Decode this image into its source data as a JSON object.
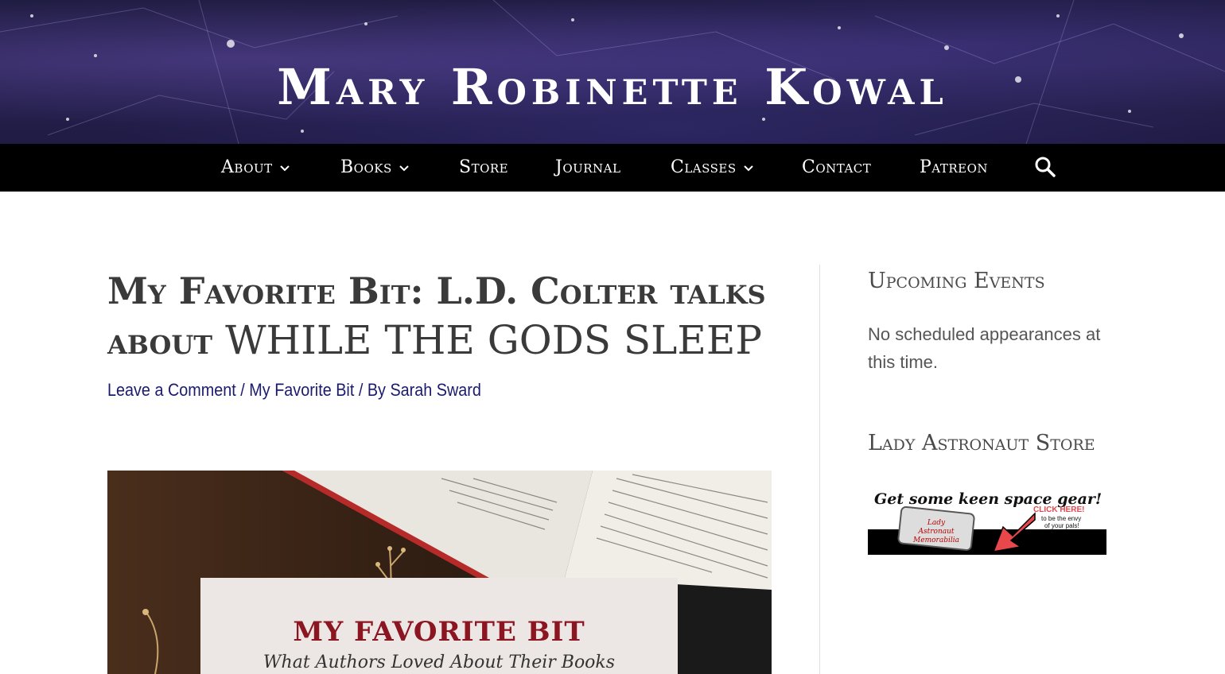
{
  "site": {
    "title": "Mary Robinette Kowal"
  },
  "nav": {
    "items": [
      {
        "label": "About",
        "has_dropdown": true
      },
      {
        "label": "Books",
        "has_dropdown": true
      },
      {
        "label": "Store",
        "has_dropdown": false
      },
      {
        "label": "Journal",
        "has_dropdown": false
      },
      {
        "label": "Classes",
        "has_dropdown": true
      },
      {
        "label": "Contact",
        "has_dropdown": false
      },
      {
        "label": "Patreon",
        "has_dropdown": false
      }
    ],
    "search_icon": "search-icon"
  },
  "post": {
    "title_prefix": "My Favorite Bit: L.D. Colter talks about",
    "title_book": "WHILE THE GODS SLEEP",
    "meta": {
      "comments": "Leave a Comment",
      "sep1": " / ",
      "category": "My Favorite Bit",
      "sep2": " / By ",
      "author": "Sarah Sward"
    },
    "image": {
      "card_title": "MY FAVORITE BIT",
      "card_subtitle": "What Authors Loved About Their Books"
    }
  },
  "sidebar": {
    "events": {
      "title": "Upcoming Events",
      "text": "No scheduled appearances at this time."
    },
    "store": {
      "title": "Lady Astronaut Store",
      "banner_headline": "Get some keen space gear!",
      "banner_cta": "CLICK HERE!",
      "banner_sub1": "to be the envy",
      "banner_sub2": "of your pals!",
      "banner_tag1": "Lady",
      "banner_tag2": "Astronaut",
      "banner_tag3": "Memorabilia"
    }
  },
  "colors": {
    "nav_bg": "#000000",
    "link": "#1b1b6e",
    "card_title": "#8b1520",
    "banner_arrow": "#e8474c"
  }
}
